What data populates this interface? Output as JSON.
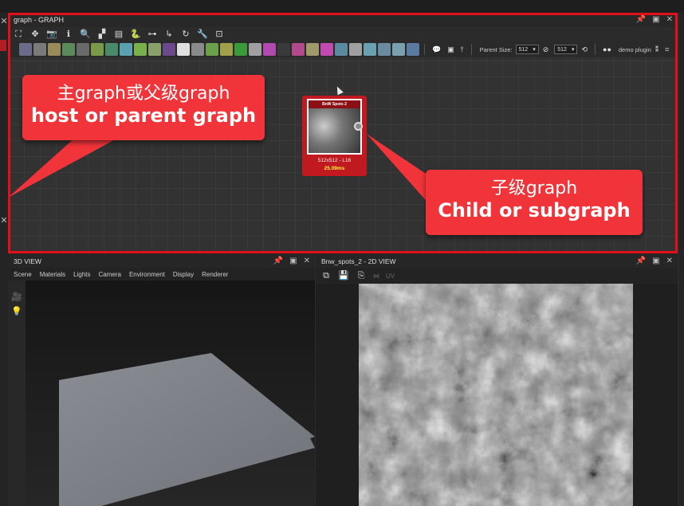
{
  "graph_panel": {
    "title": "graph - GRAPH",
    "parent_size_label": "Parent Size:",
    "parent_size_value": "512",
    "linked_size_value": "512",
    "plugin_label": "demo plugin",
    "accent_color": "#e3101c"
  },
  "node": {
    "title": "BnW Spots 2",
    "size_label": "512x512 - L16",
    "time_label": "25.09ms"
  },
  "callouts": {
    "parent": {
      "cn": "主graph或父级graph",
      "en": "host or parent graph"
    },
    "child": {
      "cn": "子级graph",
      "en": "Child or subgraph"
    }
  },
  "view3d": {
    "title": "3D VIEW",
    "menu": [
      "Scene",
      "Materials",
      "Lights",
      "Camera",
      "Environment",
      "Display",
      "Renderer"
    ]
  },
  "view2d": {
    "title": "Bnw_spots_2 - 2D VIEW",
    "uv_label": "UV"
  },
  "node_library_colors": [
    "#6b6b8a",
    "#7a7a7a",
    "#9a8a5a",
    "#5a8a5a",
    "#6a6a6a",
    "#7a9a4a",
    "#4a8a6a",
    "#5aa0b0",
    "#7ab04a",
    "#8aa06a",
    "#6a4a8a",
    "#e0e0e0",
    "#8a8a8a",
    "#6aa04a",
    "#a0a04a",
    "#3a9a3a",
    "#a0a0a0",
    "#b04ab0",
    "#3a3a3a",
    "#b04a8a",
    "#a09a6a",
    "#c04ab0",
    "#5a8aa0",
    "#a0a0a0",
    "#6aa0b0",
    "#6a8aa0",
    "#7aa0b0",
    "#5a7aa0"
  ]
}
